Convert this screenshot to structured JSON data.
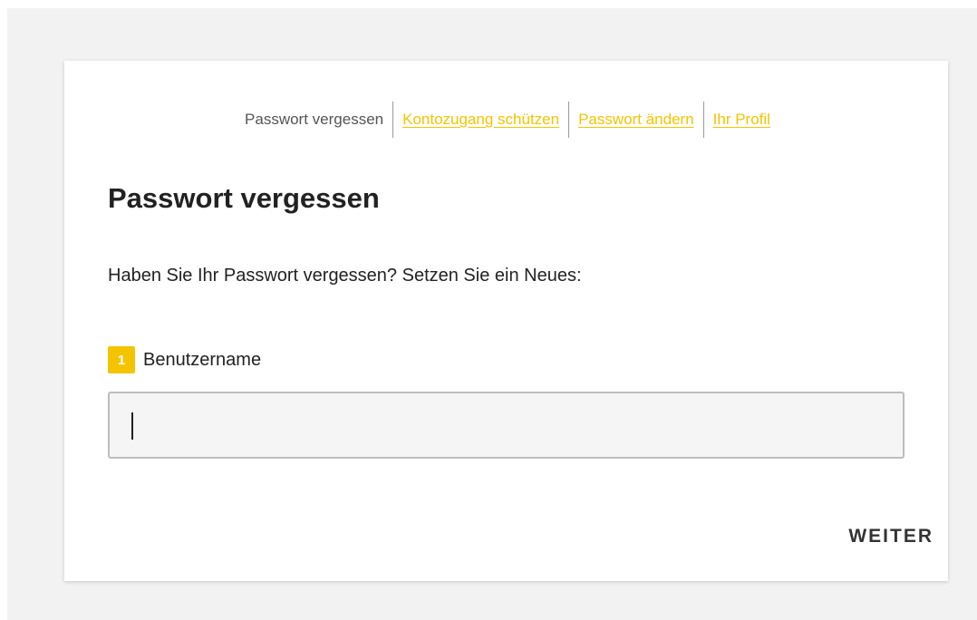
{
  "tabs": [
    {
      "label": "Passwort vergessen",
      "active": true
    },
    {
      "label": "Kontozugang schützen",
      "active": false
    },
    {
      "label": "Passwort ändern",
      "active": false
    },
    {
      "label": "Ihr Profil",
      "active": false
    }
  ],
  "page": {
    "title": "Passwort vergessen",
    "intro": "Haben Sie Ihr Passwort vergessen? Setzen Sie ein Neues:"
  },
  "form": {
    "step_number": "1",
    "username_label": "Benutzername",
    "username_value": "",
    "username_placeholder": ""
  },
  "actions": {
    "next_label": "WEITER"
  },
  "colors": {
    "accent": "#f5c400",
    "background": "#f2f2f2",
    "card": "#ffffff",
    "text": "#222222"
  }
}
